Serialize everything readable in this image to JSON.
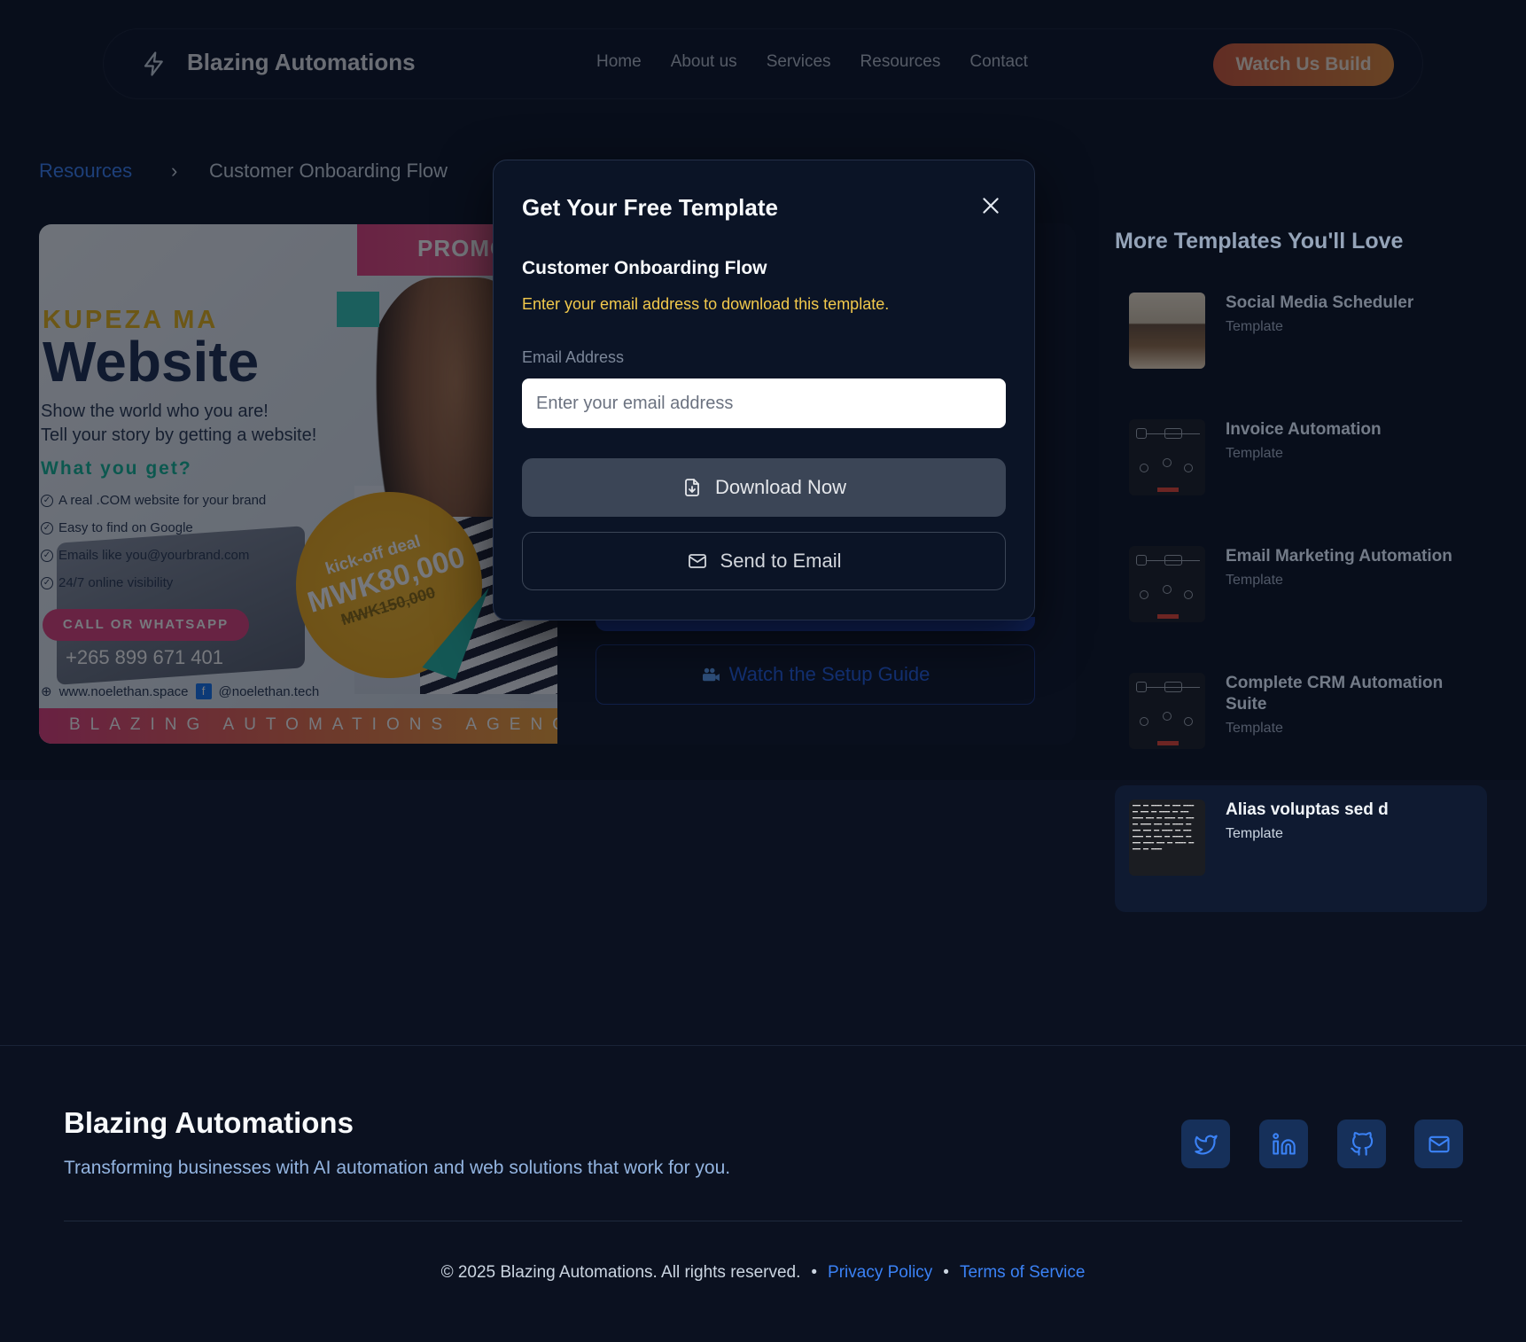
{
  "nav": {
    "brand": "Blazing Automations",
    "links": [
      "Home",
      "About us",
      "Services",
      "Resources",
      "Contact"
    ],
    "cta": "Watch Us Build"
  },
  "breadcrumb": {
    "parent": "Resources",
    "separator": "›",
    "current": "Customer Onboarding Flow"
  },
  "hero": {
    "promo": "PROMO",
    "kicker": "KUPEZA MA",
    "headline": "Website",
    "line1": "Show the world who you are!",
    "line2": "Tell your story by getting a website!",
    "what": "What you get?",
    "features": [
      "A real .COM website for your brand",
      "Easy to find on Google",
      "Emails like you@yourbrand.com",
      "24/7 online visibility"
    ],
    "deal_label": "kick-off deal",
    "deal_price": "MWK80,000",
    "deal_old": "MWK150,000",
    "call": "CALL OR WHATSAPP",
    "phone": "+265 899 671 401",
    "site": "www.noelethan.space",
    "fb_glyph": "f",
    "handle": "@noelethan.tech",
    "agency": "BLAZING AUTOMATIONS AGENCY"
  },
  "main": {
    "setup_guide": "Watch the Setup Guide"
  },
  "sidebar": {
    "title": "More Templates You'll Love",
    "items": [
      {
        "title": "Social Media Scheduler",
        "tag": "Template",
        "thumb": "room"
      },
      {
        "title": "Invoice Automation",
        "tag": "Template",
        "thumb": "flow"
      },
      {
        "title": "Email Marketing Automation",
        "tag": "Template",
        "thumb": "flow"
      },
      {
        "title": "Complete CRM Automation Suite",
        "tag": "Template",
        "thumb": "flow"
      },
      {
        "title": "Alias voluptas sed d",
        "tag": "Template",
        "thumb": "text"
      }
    ]
  },
  "modal": {
    "title": "Get Your Free Template",
    "template_name": "Customer Onboarding Flow",
    "description": "Enter your email address to download this template.",
    "email_label": "Email Address",
    "email_placeholder": "Enter your email address",
    "email_value": "",
    "download_label": "Download Now",
    "send_label": "Send to Email"
  },
  "footer": {
    "brand": "Blazing Automations",
    "tagline": "Transforming businesses with AI automation and web solutions that work for you.",
    "copyright": "© 2025 Blazing Automations. All rights reserved.",
    "bullet": "•",
    "privacy": "Privacy Policy",
    "terms": "Terms of Service",
    "socials": [
      "twitter-icon",
      "linkedin-icon",
      "github-icon",
      "mail-icon"
    ]
  },
  "colors": {
    "background": "#0b1120",
    "accent": "#3b82f6",
    "cta_gradient_start": "#d2593a",
    "cta_gradient_end": "#e08a3a",
    "modal_hint": "#f2c94c"
  }
}
